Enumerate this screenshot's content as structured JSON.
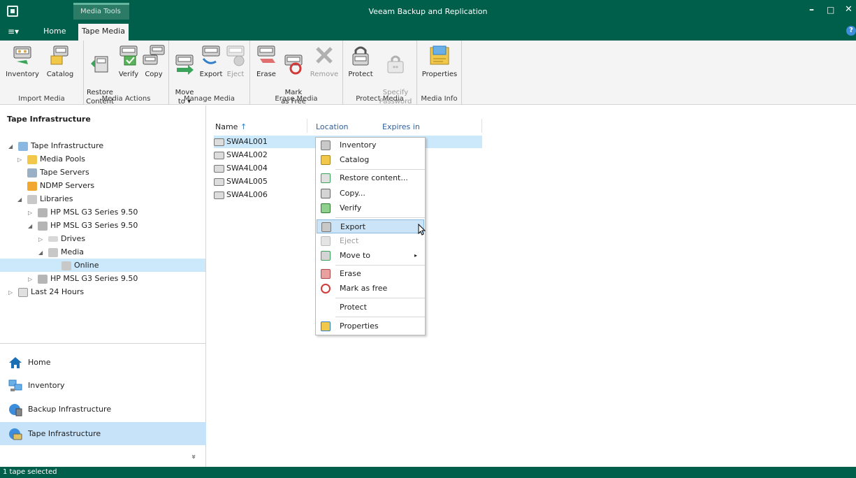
{
  "window": {
    "title": "Veeam Backup and Replication",
    "context_tab_group": "Media Tools",
    "menu_glyph": "≡▾",
    "minimize": "–",
    "maximize": "□",
    "close": "✕",
    "help": "?"
  },
  "tabs": {
    "home": "Home",
    "tape_media": "Tape Media"
  },
  "ribbon": {
    "groups": [
      {
        "label": "Import Media",
        "buttons": [
          {
            "label": "Inventory",
            "enabled": true
          },
          {
            "label": "Catalog",
            "enabled": true
          }
        ]
      },
      {
        "label": "Media Actions",
        "buttons": [
          {
            "label": "Restore\nContent",
            "enabled": true
          },
          {
            "label": "Verify",
            "enabled": true
          },
          {
            "label": "Copy",
            "enabled": true
          }
        ]
      },
      {
        "label": "Manage Media",
        "buttons": [
          {
            "label": "Move\nto ▾",
            "enabled": true
          },
          {
            "label": "Export",
            "enabled": true
          },
          {
            "label": "Eject",
            "enabled": false
          }
        ]
      },
      {
        "label": "Erase Media",
        "buttons": [
          {
            "label": "Erase",
            "enabled": true
          },
          {
            "label": "Mark\nas Free",
            "enabled": true
          },
          {
            "label": "Remove",
            "enabled": false
          }
        ]
      },
      {
        "label": "Protect Media",
        "buttons": [
          {
            "label": "Protect",
            "enabled": true
          },
          {
            "label": "Specify\nPassword",
            "enabled": false
          }
        ]
      },
      {
        "label": "Media Info",
        "buttons": [
          {
            "label": "Properties",
            "enabled": true
          }
        ]
      }
    ]
  },
  "tree": {
    "header": "Tape Infrastructure",
    "items": [
      {
        "label": "Tape Infrastructure",
        "arrow": "◢"
      },
      {
        "label": "Media Pools",
        "arrow": "▷"
      },
      {
        "label": "Tape Servers",
        "arrow": ""
      },
      {
        "label": "NDMP Servers",
        "arrow": ""
      },
      {
        "label": "Libraries",
        "arrow": "◢"
      },
      {
        "label": "HP MSL G3 Series 9.50",
        "arrow": "▷"
      },
      {
        "label": "HP MSL G3 Series 9.50",
        "arrow": "◢"
      },
      {
        "label": "Drives",
        "arrow": "▷"
      },
      {
        "label": "Media",
        "arrow": "◢"
      },
      {
        "label": "Online",
        "arrow": ""
      },
      {
        "label": "HP MSL G3 Series 9.50",
        "arrow": "▷"
      },
      {
        "label": "Last 24 Hours",
        "arrow": "▷"
      }
    ]
  },
  "nav": {
    "items": [
      {
        "label": "Home"
      },
      {
        "label": "Inventory"
      },
      {
        "label": "Backup Infrastructure"
      },
      {
        "label": "Tape Infrastructure"
      }
    ],
    "more": "»"
  },
  "table": {
    "columns": {
      "name": "Name",
      "sort_arrow": "↑",
      "location": "Location",
      "expires": "Expires in"
    },
    "rows": [
      "SWA4L001",
      "SWA4L002",
      "SWA4L004",
      "SWA4L005",
      "SWA4L006"
    ]
  },
  "context_menu": {
    "items": [
      {
        "label": "Inventory",
        "enabled": true
      },
      {
        "label": "Catalog",
        "enabled": true
      },
      {
        "label": "Restore content...",
        "enabled": true
      },
      {
        "label": "Copy...",
        "enabled": true
      },
      {
        "label": "Verify",
        "enabled": true
      },
      {
        "label": "Export",
        "enabled": true
      },
      {
        "label": "Eject",
        "enabled": false
      },
      {
        "label": "Move to",
        "enabled": true
      },
      {
        "label": "Erase",
        "enabled": true
      },
      {
        "label": "Mark as free",
        "enabled": true
      },
      {
        "label": "Protect",
        "enabled": true
      },
      {
        "label": "Properties",
        "enabled": true
      }
    ],
    "submenu_arrow": "▸"
  },
  "status": {
    "text": "1 tape selected"
  },
  "colors": {
    "brand": "#005f4b",
    "selection": "#cce8fb",
    "hover_border": "#87b8e0"
  }
}
